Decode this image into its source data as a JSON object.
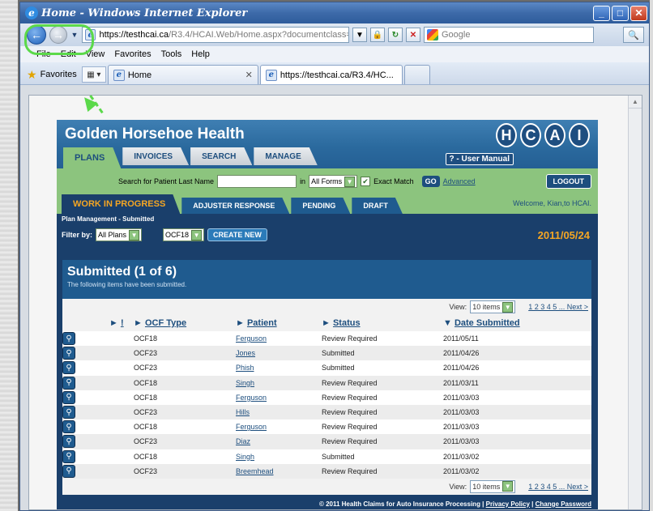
{
  "window": {
    "title": "Home - Windows Internet Explorer",
    "controls": [
      "_",
      "□",
      "✕"
    ]
  },
  "addressbar": {
    "url_host": "https://testhcai.ca",
    "url_path": "/R3.4/HCAI.Web/Home.aspx?documentclass=1",
    "search_placeholder": "Google"
  },
  "menu": [
    "File",
    "Edit",
    "View",
    "Favorites",
    "Tools",
    "Help"
  ],
  "favbar": {
    "favorites_label": "Favorites",
    "tabs": [
      {
        "label": "Home"
      },
      {
        "label": "https://testhcai.ca/R3.4/HC..."
      }
    ]
  },
  "app": {
    "org_title": "Golden Horsehoe Health",
    "logo_letters": [
      "H",
      "C",
      "A",
      "I"
    ],
    "main_tabs": [
      "PLANS",
      "INVOICES",
      "SEARCH",
      "MANAGE"
    ],
    "user_manual": "? - User Manual",
    "search": {
      "label": "Search for Patient Last Name",
      "in_label": "in",
      "forms_value": "All Forms",
      "exact_match": "Exact Match",
      "go": "GO",
      "advanced": "Advanced",
      "logout": "LOGOUT"
    },
    "sub_tabs": [
      "WORK IN PROGRESS",
      "ADJUSTER RESPONSE",
      "PENDING",
      "DRAFT"
    ],
    "welcome": "Welcome, Kian,to HCAI.",
    "crumb": "Plan Management - Submitted",
    "filter": {
      "label": "Filter by:",
      "plans_value": "All Plans",
      "ocf_value": "OCF18",
      "create": "CREATE NEW"
    },
    "date": "2011/05/24",
    "panel": {
      "title": "Submitted (1 of 6)",
      "subtitle": "The following items have been submitted.",
      "view_label": "View:",
      "view_value": "10 items",
      "pages": "1 2 3 4 5 ... Next >"
    },
    "columns": [
      "!",
      "OCF Type",
      "Patient",
      "Status",
      "Date Submitted"
    ],
    "rows": [
      {
        "type": "OCF18",
        "patient": "Ferguson",
        "status": "Review Required",
        "date": "2011/05/11"
      },
      {
        "type": "OCF23",
        "patient": "Jones",
        "status": "Submitted",
        "date": "2011/04/26"
      },
      {
        "type": "OCF23",
        "patient": "Phish",
        "status": "Submitted",
        "date": "2011/04/26"
      },
      {
        "type": "OCF18",
        "patient": "Singh",
        "status": "Review Required",
        "date": "2011/03/11"
      },
      {
        "type": "OCF18",
        "patient": "Ferguson",
        "status": "Review Required",
        "date": "2011/03/03"
      },
      {
        "type": "OCF23",
        "patient": "Hills",
        "status": "Review Required",
        "date": "2011/03/03"
      },
      {
        "type": "OCF18",
        "patient": "Ferguson",
        "status": "Review Required",
        "date": "2011/03/03"
      },
      {
        "type": "OCF23",
        "patient": "Diaz",
        "status": "Review Required",
        "date": "2011/03/03"
      },
      {
        "type": "OCF18",
        "patient": "Singh",
        "status": "Submitted",
        "date": "2011/03/02"
      },
      {
        "type": "OCF23",
        "patient": "Breemhead",
        "status": "Review Required",
        "date": "2011/03/02"
      }
    ],
    "footer": {
      "copyright": "© 2011 Health Claims for Auto Insurance Processing |",
      "privacy": "Privacy Policy",
      "sep": "|",
      "change_password": "Change Password"
    }
  }
}
